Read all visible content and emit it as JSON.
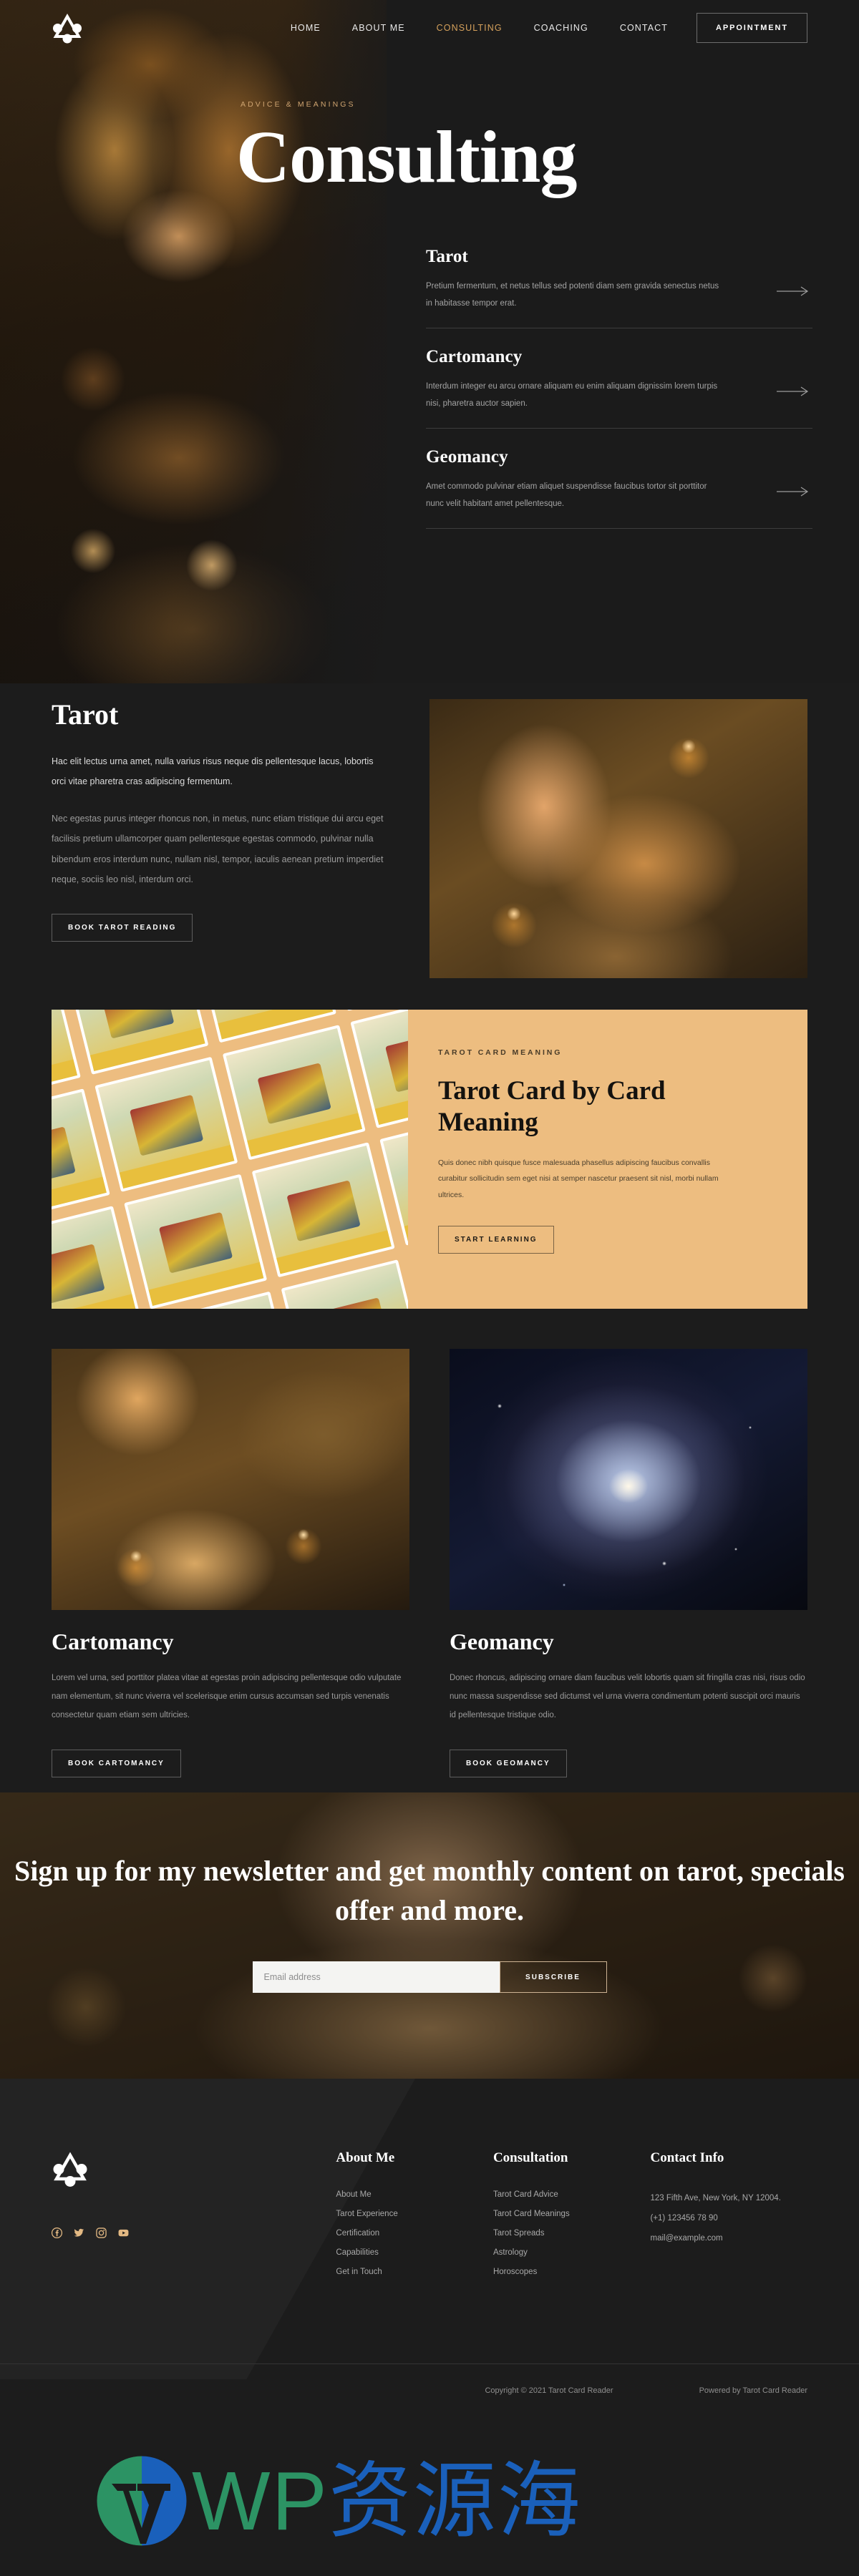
{
  "theme": {
    "bg": "#1c1c1c",
    "accent": "#d5a15c",
    "banner_bg": "#edbd80",
    "muted_text": "#9b9b9b"
  },
  "header": {
    "logo_icon": "triangle-trinity-logo-icon",
    "nav": [
      {
        "label": "HOME",
        "active": false
      },
      {
        "label": "ABOUT ME",
        "active": false
      },
      {
        "label": "CONSULTING",
        "active": true
      },
      {
        "label": "COACHING",
        "active": false
      },
      {
        "label": "CONTACT",
        "active": false
      }
    ],
    "appointment_label": "APPOINTMENT"
  },
  "hero": {
    "eyebrow": "ADVICE & MEANINGS",
    "title": "Consulting",
    "services": [
      {
        "title": "Tarot",
        "text": "Pretium fermentum, et netus tellus sed potenti diam sem gravida senectus netus in habitasse tempor erat.",
        "arrow_icon": "arrow-right-icon"
      },
      {
        "title": "Cartomancy",
        "text": "Interdum integer eu arcu ornare aliquam eu enim aliquam dignissim lorem turpis nisi, pharetra auctor sapien.",
        "arrow_icon": "arrow-right-icon"
      },
      {
        "title": "Geomancy",
        "text": "Amet commodo pulvinar etiam aliquet suspendisse faucibus tortor sit porttitor nunc velit habitant amet pellentesque.",
        "arrow_icon": "arrow-right-icon"
      }
    ]
  },
  "tarot_section": {
    "title": "Tarot",
    "lead": "Hac elit lectus urna amet, nulla varius risus neque dis pellentesque lacus, lobortis orci vitae pharetra cras adipiscing fermentum.",
    "body": "Nec egestas purus integer rhoncus non, in metus, nunc etiam tristique dui arcu eget facilisis pretium ullamcorper quam pellentesque egestas commodo, pulvinar nulla bibendum eros interdum nunc, nullam nisl, tempor, iaculis aenean pretium imperdiet neque, sociis leo nisl, interdum orci.",
    "button": "BOOK TAROT READING",
    "image_alt": "hands-reading-tarot-cards-by-candlelight"
  },
  "meaning_banner": {
    "eyebrow": "TAROT CARD MEANING",
    "title": "Tarot Card by Card Meaning",
    "text": "Quis donec nibh quisque fusce malesuada phasellus adipiscing faucibus convallis curabitur sollicitudin sem eget nisi at semper nascetur praesent sit nisl, morbi nullam ultrices.",
    "button": "START LEARNING",
    "image_alt": "rider-waite-tarot-cards-grid"
  },
  "services_two_col": [
    {
      "title": "Cartomancy",
      "text": "Lorem vel urna, sed porttitor platea vitae at egestas proin adipiscing pellentesque odio vulputate nam elementum, sit nunc viverra vel scelerisque enim cursus accumsan sed turpis venenatis consectetur quam etiam sem ultricies.",
      "button": "BOOK CARTOMANCY",
      "image_alt": "woman-laying-playing-cards-in-arc-by-candlelight"
    },
    {
      "title": "Geomancy",
      "text": "Donec rhoncus, adipiscing ornare diam faucibus velit lobortis quam sit fringilla cras nisi, risus odio nunc massa suspendisse sed dictumst vel urna viverra condimentum potenti suscipit orci mauris id pellentesque tristique odio.",
      "button": "BOOK GEOMANCY",
      "image_alt": "spiral-galaxy-in-deep-space"
    }
  ],
  "newsletter": {
    "heading": "Sign up for my newsletter and get monthly content on tarot, specials offer and more.",
    "email_placeholder": "Email address",
    "email_value": "",
    "subscribe_label": "SUBSCRIBE"
  },
  "footer": {
    "logo_icon": "triangle-trinity-logo-icon",
    "social": [
      {
        "icon": "facebook-icon"
      },
      {
        "icon": "twitter-icon"
      },
      {
        "icon": "instagram-icon"
      },
      {
        "icon": "youtube-icon"
      }
    ],
    "columns": [
      {
        "heading": "About Me",
        "items": [
          "About Me",
          "Tarot Experience",
          "Certification",
          "Capabilities",
          "Get in Touch"
        ]
      },
      {
        "heading": "Consultation",
        "items": [
          "Tarot Card Advice",
          "Tarot Card Meanings",
          "Tarot Spreads",
          "Astrology",
          "Horoscopes"
        ]
      }
    ],
    "contact": {
      "heading": "Contact Info",
      "address": "123 Fifth Ave, New York, NY 12004.",
      "phone": "(+1) 123456 78 90",
      "email": "mail@example.com"
    },
    "copyright": "Copyright © 2021 Tarot Card Reader",
    "powered_by": "Powered by Tarot Card Reader"
  },
  "watermark": {
    "icon": "wordpress-logo-icon",
    "latin": "WP",
    "cjk": "资源海"
  }
}
